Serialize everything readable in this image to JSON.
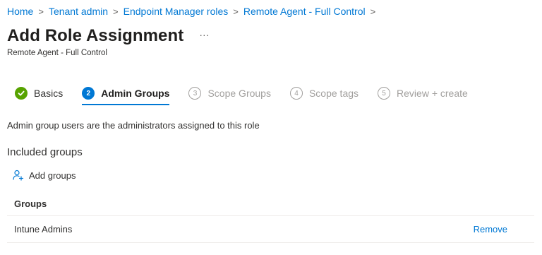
{
  "breadcrumb": {
    "items": [
      "Home",
      "Tenant admin",
      "Endpoint Manager roles",
      "Remote Agent - Full Control"
    ],
    "separator": ">"
  },
  "header": {
    "title": "Add Role Assignment",
    "more_label": "···",
    "subtitle": "Remote Agent - Full Control"
  },
  "wizard": {
    "steps": [
      {
        "number": "✓",
        "label": "Basics",
        "state": "done"
      },
      {
        "number": "2",
        "label": "Admin Groups",
        "state": "active"
      },
      {
        "number": "3",
        "label": "Scope Groups",
        "state": "todo"
      },
      {
        "number": "4",
        "label": "Scope tags",
        "state": "todo"
      },
      {
        "number": "5",
        "label": "Review + create",
        "state": "todo"
      }
    ]
  },
  "main": {
    "description": "Admin group users are the administrators assigned to this role",
    "section_title": "Included groups",
    "add_groups_label": "Add groups",
    "table": {
      "header": "Groups",
      "rows": [
        {
          "name": "Intune Admins",
          "action": "Remove"
        }
      ]
    }
  },
  "colors": {
    "accent": "#0078d4",
    "success": "#57a300",
    "muted": "#a19f9d"
  }
}
